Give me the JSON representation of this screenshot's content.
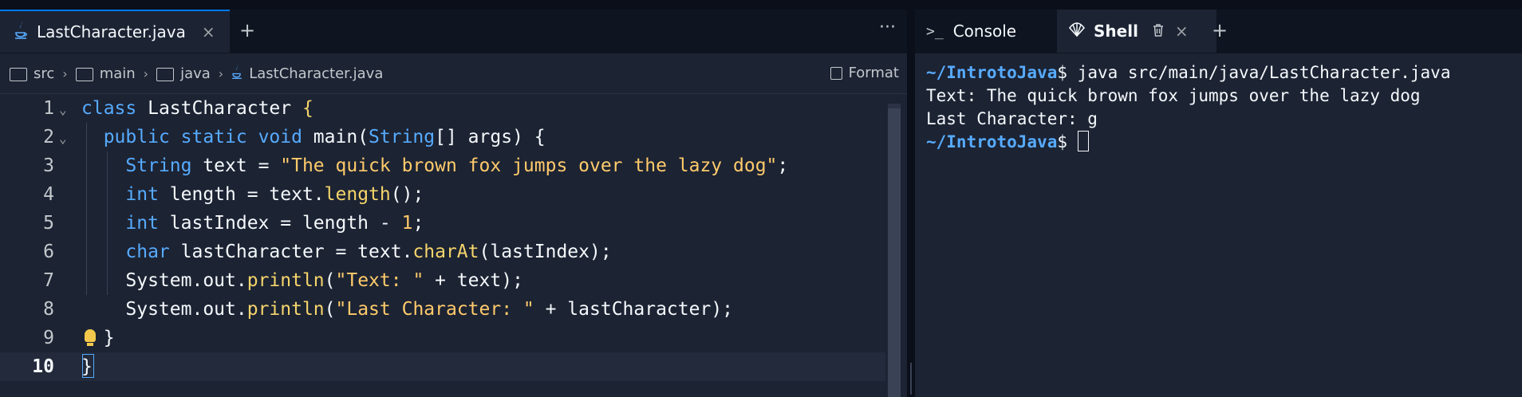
{
  "editor": {
    "tab_label": "LastCharacter.java",
    "tab_close": "×",
    "new_tab": "+",
    "more": "···",
    "breadcrumb": [
      "src",
      "main",
      "java",
      "LastCharacter.java"
    ],
    "format_label": "Format",
    "line_numbers": [
      "1",
      "2",
      "3",
      "4",
      "5",
      "6",
      "7",
      "8",
      "9",
      "10"
    ],
    "code": {
      "l1": {
        "kw": "class",
        "name": " LastCharacter ",
        "brace": "{"
      },
      "l2": {
        "kw": "public static void",
        "sig": " main(",
        "type": "String",
        "rest": "[] args) {"
      },
      "l3": {
        "type": "String",
        "mid": " text = ",
        "str": "\"The quick brown fox jumps over the lazy dog\"",
        "end": ";"
      },
      "l4": {
        "type": "int",
        "mid": " length = text.",
        "fn": "length",
        "end": "();"
      },
      "l5": {
        "type": "int",
        "mid": " lastIndex = length - ",
        "num": "1",
        "end": ";"
      },
      "l6": {
        "type": "char",
        "mid": " lastCharacter = text.",
        "fn": "charAt",
        "end": "(lastIndex);"
      },
      "l7": {
        "pre": "System.out.",
        "fn": "println",
        "open": "(",
        "str": "\"Text: \"",
        "end": " + text);"
      },
      "l8": {
        "pre": "System.out.",
        "fn": "println",
        "open": "(",
        "str": "\"Last Character: \"",
        "end": " + lastCharacter);"
      },
      "l9": {
        "text": "}"
      },
      "l10": {
        "text": "}"
      }
    }
  },
  "shell": {
    "tabs": [
      {
        "label": "Console",
        "icon": "terminal-icon"
      },
      {
        "label": "Shell",
        "icon": "shell-icon"
      }
    ],
    "tab_close": "×",
    "new_tab": "+",
    "lines": {
      "cmd_prompt": "~/IntrotoJava",
      "cmd_dollar": "$",
      "cmd_text": " java src/main/java/LastCharacter.java",
      "out1": "Text: The quick brown fox jumps over the lazy dog",
      "out2": "Last Character: g",
      "prompt2": "~/IntrotoJava",
      "dollar2": "$"
    }
  }
}
